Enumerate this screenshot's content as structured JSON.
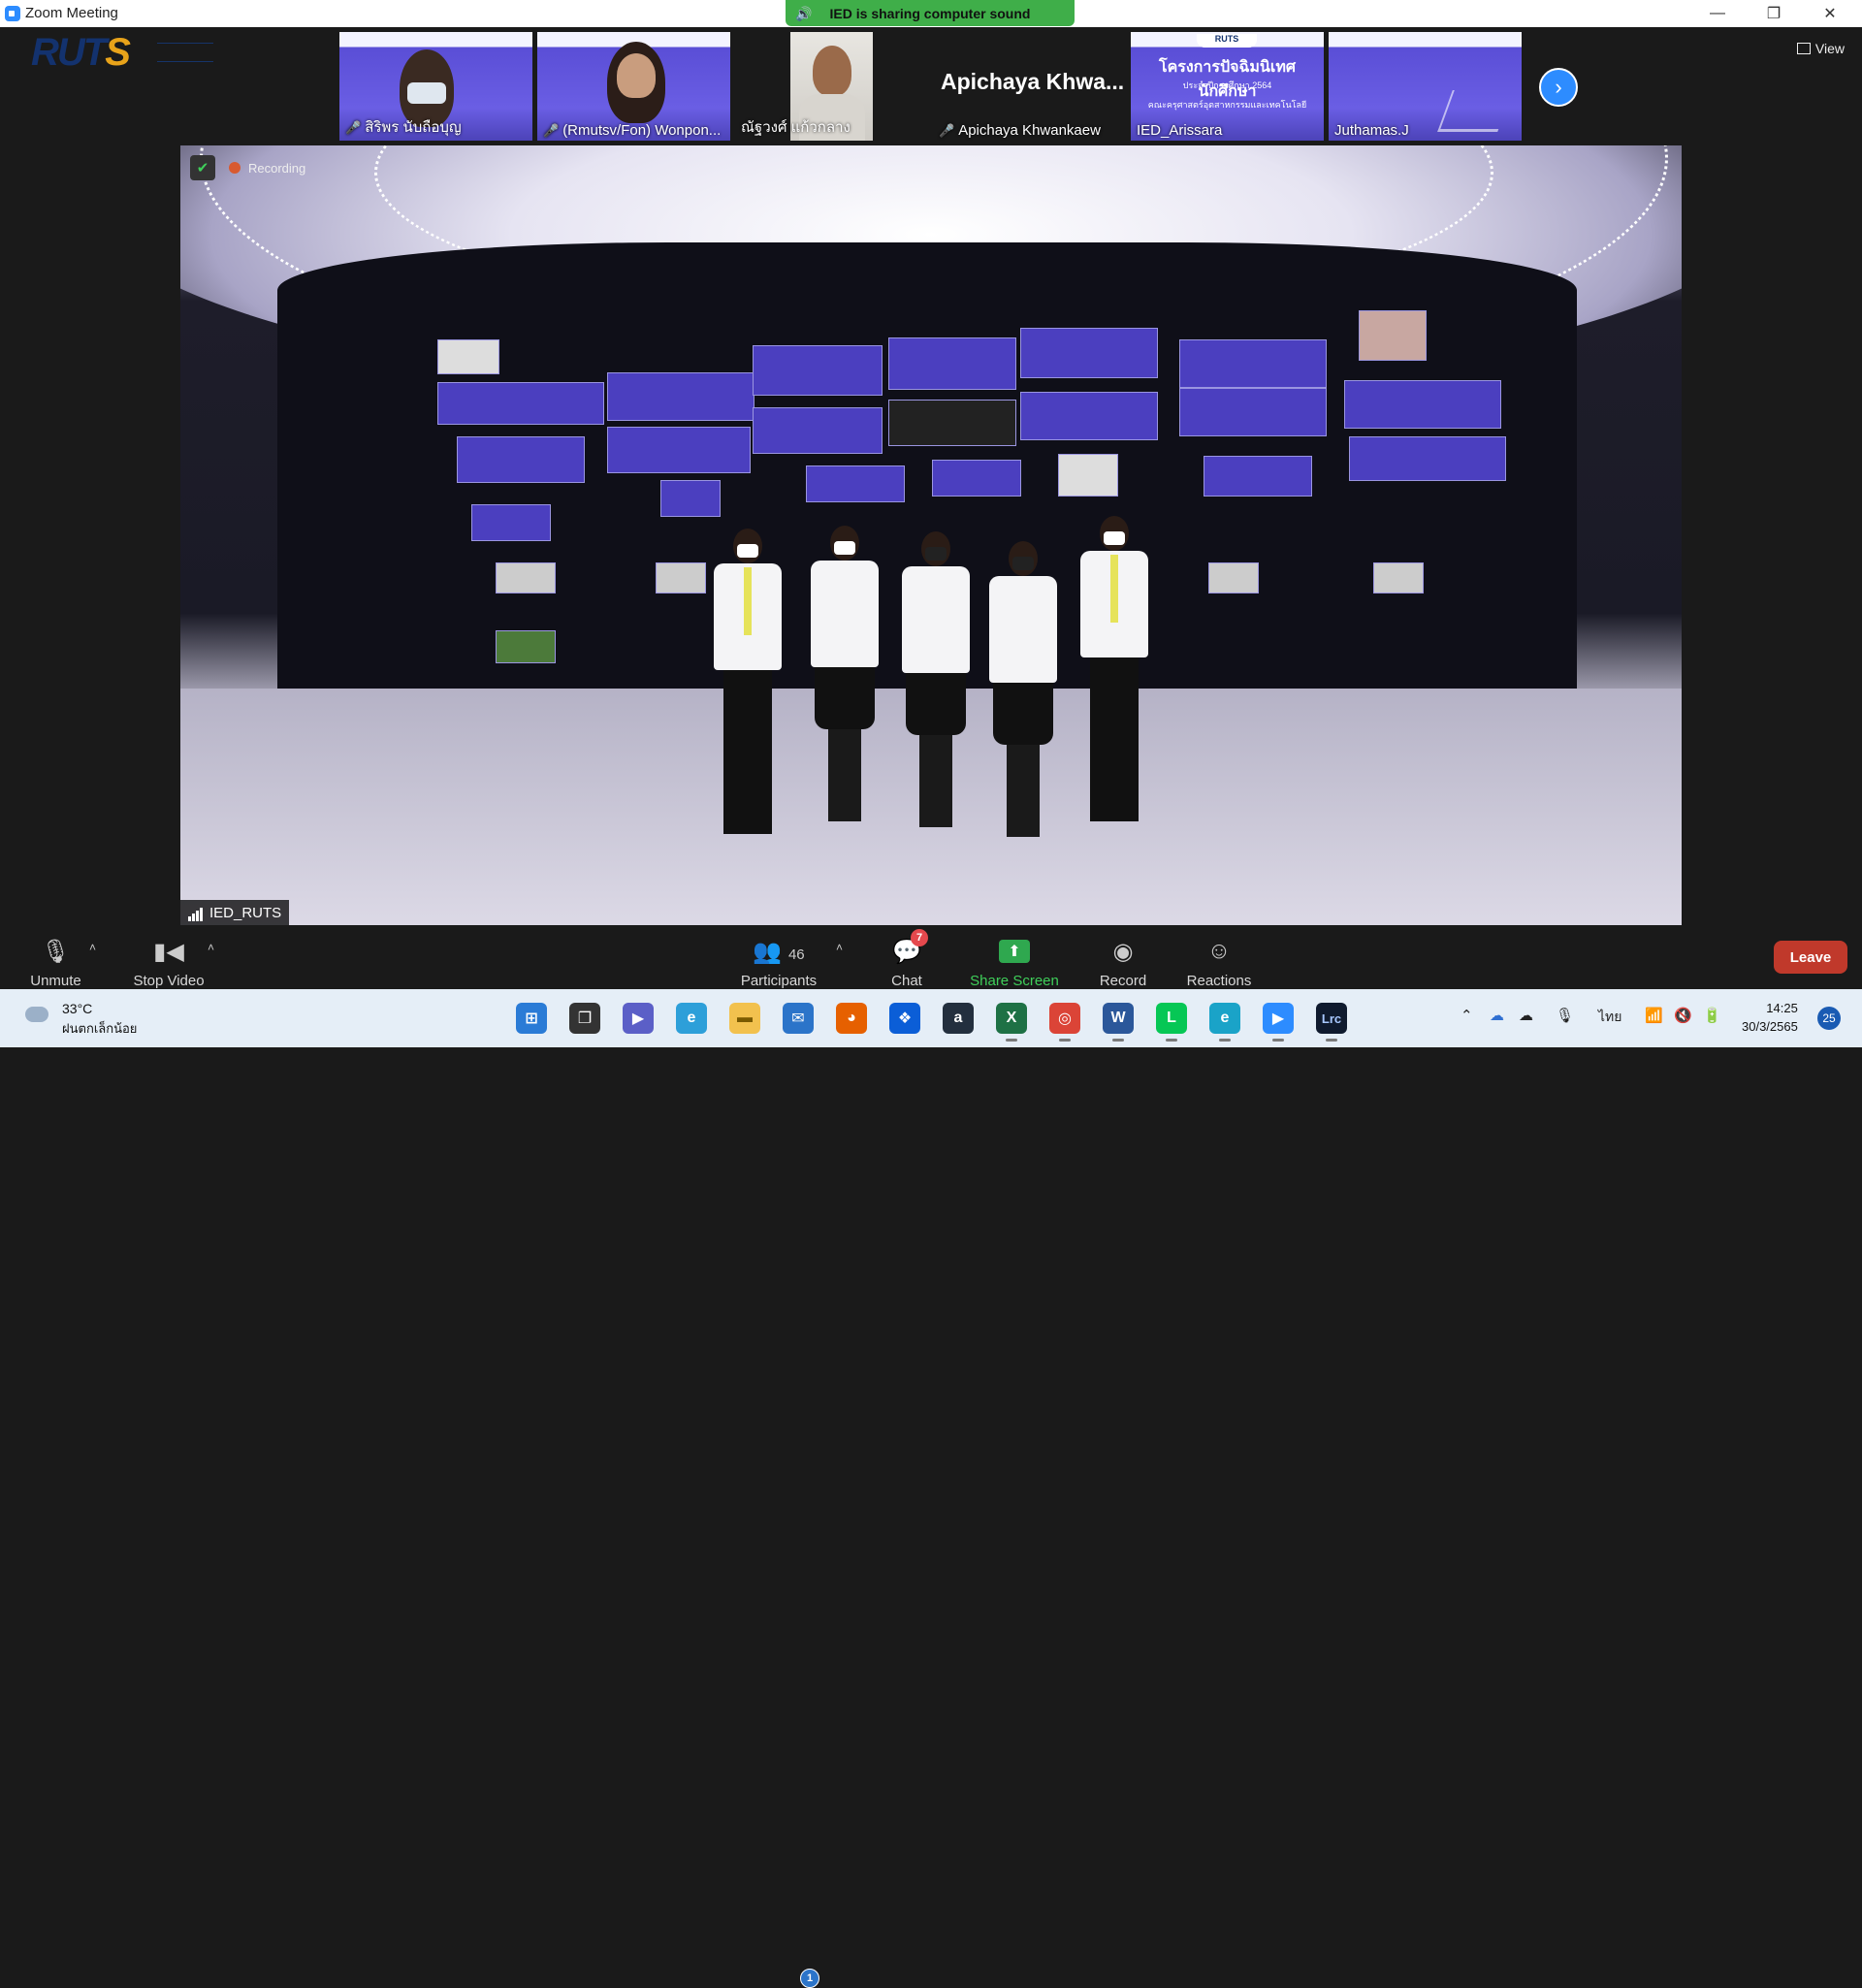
{
  "window": {
    "title": "Zoom Meeting",
    "minimize": "—",
    "restore": "❐",
    "close": "✕"
  },
  "share_banner": {
    "text": "IED is sharing computer sound"
  },
  "gallery": {
    "view_label": "View",
    "tiles": [
      {
        "name": "สิริพร นับถือบุญ",
        "muted": true
      },
      {
        "name": "(Rmutsv/Fon) Wonpon...",
        "muted": true
      },
      {
        "name": "ณัฐวงศ์ แก้วกลาง",
        "muted": false
      },
      {
        "name": "Apichaya Khwankaew",
        "display_name": "Apichaya  Khwa...",
        "muted": true
      },
      {
        "name": "IED_Arissara",
        "muted": false,
        "slide_lines": [
          "RUTS",
          "โครงการปัจฉิมนิเทศนักศึกษา",
          "ประจำปีการศึกษา 2564",
          "คณะครุศาสตร์อุตสาหกรรมและเทคโนโลยี"
        ]
      },
      {
        "name": "Juthamas.J",
        "muted": false
      }
    ]
  },
  "main_video": {
    "recording_label": "Recording",
    "speaker_name": "IED_RUTS"
  },
  "toolbar": {
    "unmute": "Unmute",
    "stop_video": "Stop Video",
    "participants": "Participants",
    "participants_count": "46",
    "chat": "Chat",
    "chat_badge": "7",
    "share_screen": "Share Screen",
    "record": "Record",
    "reactions": "Reactions",
    "leave": "Leave"
  },
  "taskbar": {
    "weather_temp": "33°C",
    "weather_cond": "ฝนตกเล็กน้อย",
    "language": "ไทย",
    "time": "14:25",
    "date": "30/3/2565",
    "notification_count": "25",
    "mail_badge": "1"
  },
  "colors": {
    "zoom_blue": "#2d8cff",
    "share_green": "#3fae49",
    "leave_red": "#c0392b",
    "slide_purple": "#5a4ed6"
  }
}
